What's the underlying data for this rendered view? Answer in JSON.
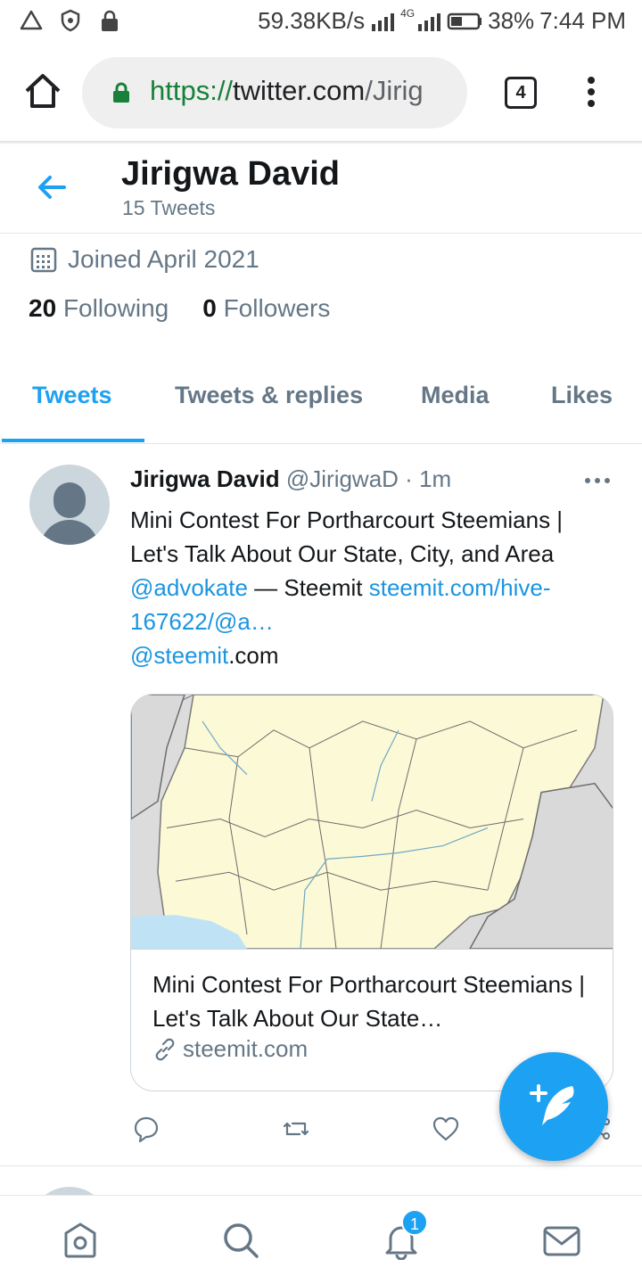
{
  "status_bar": {
    "speed": "59.38KB/s",
    "network": "4G",
    "battery": "38%",
    "time": "7:44 PM",
    "left_icons": [
      "alert-triangle-icon",
      "shield-icon",
      "lock-icon"
    ]
  },
  "browser": {
    "url_scheme": "https://",
    "url_host": "twitter.com",
    "url_path": "/Jirig",
    "tab_count": "4"
  },
  "profile": {
    "name": "Jirigwa David",
    "tweet_count": "15 Tweets",
    "joined": "Joined April 2021",
    "following_count": "20",
    "following_label": "Following",
    "followers_count": "0",
    "followers_label": "Followers"
  },
  "tabs": [
    {
      "label": "Tweets",
      "active": true
    },
    {
      "label": "Tweets & replies",
      "active": false
    },
    {
      "label": "Media",
      "active": false
    },
    {
      "label": "Likes",
      "active": false
    }
  ],
  "tweet": {
    "author": "Jirigwa David",
    "handle": "@JirigwaD",
    "separator": "·",
    "time": "1m",
    "text_line1": "Mini Contest For Portharcourt Steemians |",
    "text_line2": "Let's Talk About Our State, City, and Area",
    "mention1": "@advokate",
    "dash_text": " — Steemit ",
    "link_text": "steemit.com/hive-167622/@a…",
    "mention2": "@steemit",
    "mention2_suffix": ".com",
    "card_title": "Mini Contest For Portharcourt Steemians | Let's Talk About Our State…",
    "card_domain": "steemit.com"
  },
  "colors": {
    "accent": "#1da1f2",
    "text": "#14171a",
    "muted": "#657786"
  },
  "notifications_badge": "1"
}
